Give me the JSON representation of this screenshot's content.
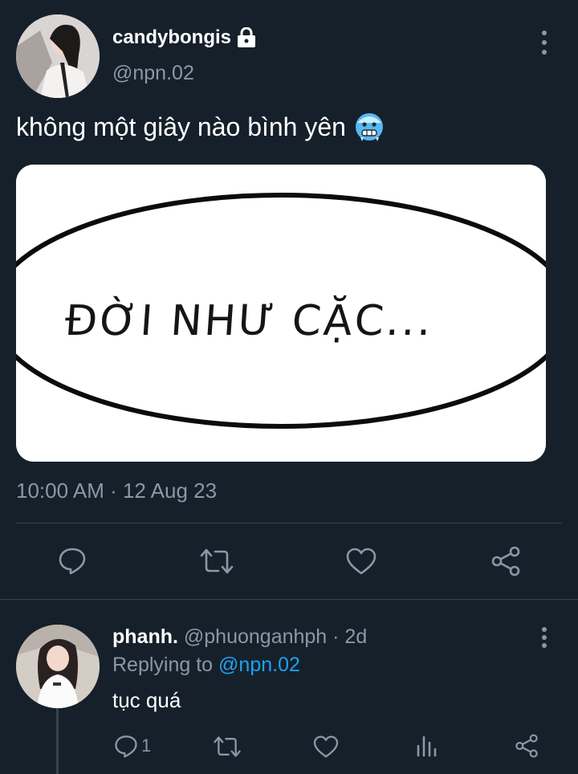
{
  "tweet": {
    "author_name": "candybongis",
    "author_handle": "@npn.02",
    "text": "không một giây nào bình yên",
    "emoji": "cold-face-emoji",
    "media_caption": "ĐỜI NHƯ CẶC...",
    "timestamp": "10:00 AM · 12 Aug 23",
    "icons": {
      "lock": "lock-icon",
      "more": "more-vertical-icon",
      "reply": "reply-icon",
      "retweet": "retweet-icon",
      "like": "heart-icon",
      "share": "share-icon"
    }
  },
  "reply": {
    "author_name": "phanh.",
    "meta": "@phuonganhph · 2d",
    "replying_prefix": "Replying to",
    "replying_handle": "@npn.02",
    "text": "tục quá",
    "reply_count": "1",
    "icons": {
      "reply": "reply-icon",
      "retweet": "retweet-icon",
      "like": "heart-icon",
      "analytics": "analytics-icon",
      "share": "share-icon",
      "more": "more-vertical-icon"
    }
  },
  "colors": {
    "background": "#15202b",
    "secondary_text": "#8899a6",
    "link": "#1da1f2",
    "divider": "#38444d"
  }
}
